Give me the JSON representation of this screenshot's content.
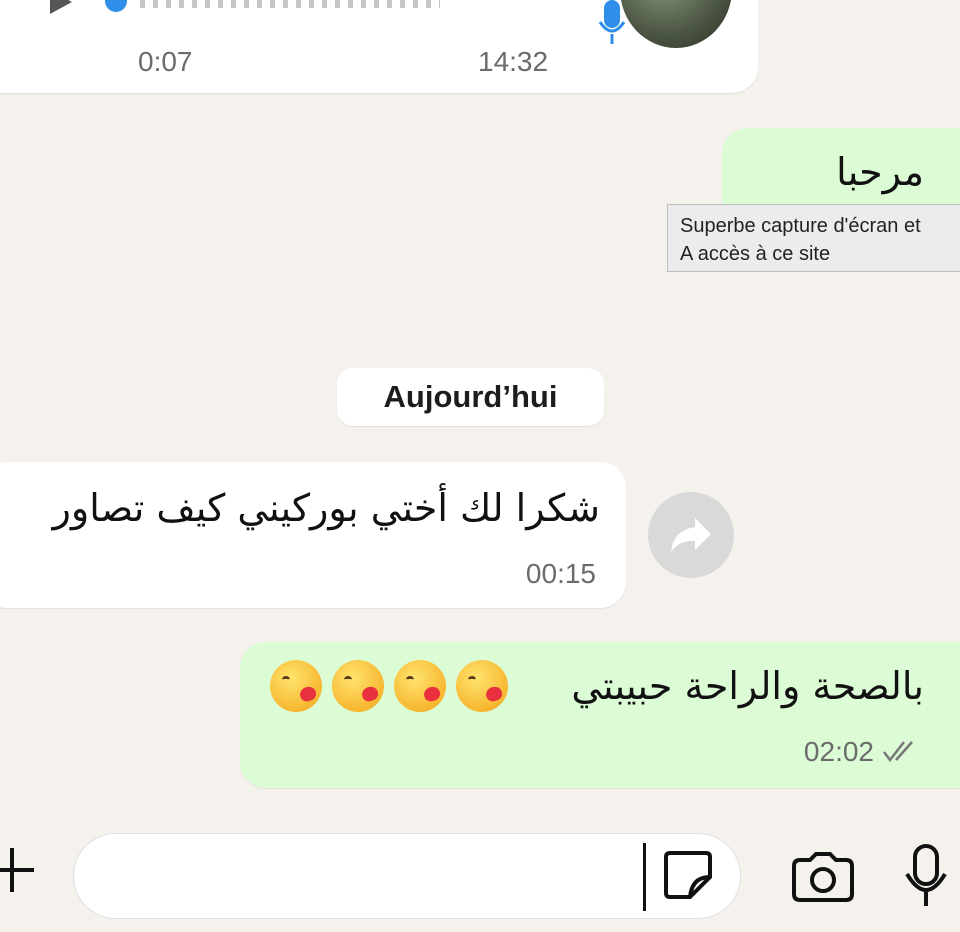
{
  "voice_message": {
    "duration": "0:07",
    "time": "14:32"
  },
  "messages": [
    {
      "id": "out1",
      "text": "مرحبا"
    },
    {
      "id": "in1",
      "text": "شكرا لك أختي بوركيني كيف تصاور",
      "time": "00:15"
    },
    {
      "id": "out2",
      "text": "بالصحة والراحة حبيبتي",
      "time": "02:02"
    }
  ],
  "tooltip": {
    "line1": "Superbe capture d'écran et",
    "line2": "A accès à ce site"
  },
  "date_chip": "Aujourd’hui",
  "input": {
    "value": "",
    "placeholder": ""
  },
  "icons": {
    "forward": "forward-icon",
    "plus": "plus-icon",
    "sticker": "sticker-icon",
    "camera": "camera-icon",
    "mic": "microphone-icon",
    "read_receipt": "double-check-icon"
  },
  "colors": {
    "outgoing_bubble": "#dcfcd5",
    "incoming_bubble": "#ffffff",
    "background": "#f5f2ee"
  }
}
